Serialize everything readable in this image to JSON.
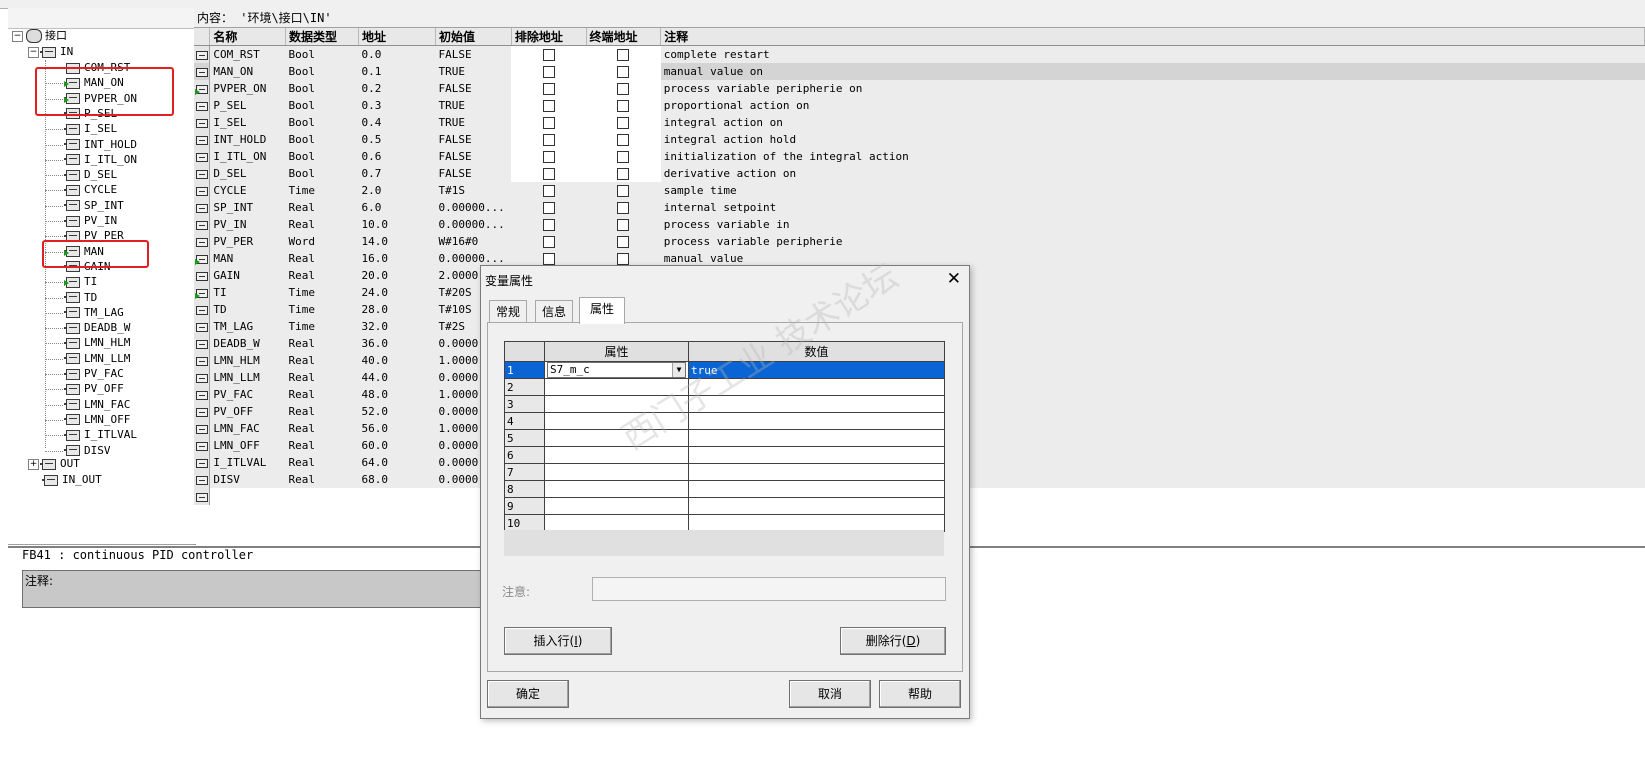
{
  "window": {
    "title_strip": ""
  },
  "tree": {
    "root": "接口",
    "in_folder": "IN",
    "in_items": [
      "COM_RST",
      "MAN_ON",
      "PVPER_ON",
      "P_SEL",
      "I_SEL",
      "INT_HOLD",
      "I_ITL_ON",
      "D_SEL",
      "CYCLE",
      "SP_INT",
      "PV_IN",
      "PV_PER",
      "MAN",
      "GAIN",
      "TI",
      "TD",
      "TM_LAG",
      "DEADB_W",
      "LMN_HLM",
      "LMN_LLM",
      "PV_FAC",
      "PV_OFF",
      "LMN_FAC",
      "LMN_OFF",
      "I_ITLVAL",
      "DISV"
    ],
    "out_folder": "OUT",
    "inout_folder": "IN_OUT",
    "expand_plus": "+",
    "expand_minus": "−"
  },
  "content_path": "内容：  '环境\\接口\\IN'",
  "table": {
    "headers": {
      "name": "名称",
      "type": "数据类型",
      "address": "地址",
      "initial": "初始值",
      "exclude": "排除地址",
      "terminal": "终端地址",
      "comment": "注释"
    },
    "rows": [
      {
        "name": "COM_RST",
        "type": "Bool",
        "address": "0.0",
        "initial": "FALSE",
        "comment": "complete restart"
      },
      {
        "name": "MAN_ON",
        "type": "Bool",
        "address": "0.1",
        "initial": "TRUE",
        "comment": "manual value on"
      },
      {
        "name": "PVPER_ON",
        "type": "Bool",
        "address": "0.2",
        "initial": "FALSE",
        "comment": "process variable peripherie on"
      },
      {
        "name": "P_SEL",
        "type": "Bool",
        "address": "0.3",
        "initial": "TRUE",
        "comment": "proportional action on"
      },
      {
        "name": "I_SEL",
        "type": "Bool",
        "address": "0.4",
        "initial": "TRUE",
        "comment": "integral action on"
      },
      {
        "name": "INT_HOLD",
        "type": "Bool",
        "address": "0.5",
        "initial": "FALSE",
        "comment": "integral action hold"
      },
      {
        "name": "I_ITL_ON",
        "type": "Bool",
        "address": "0.6",
        "initial": "FALSE",
        "comment": "initialization of the integral action"
      },
      {
        "name": "D_SEL",
        "type": "Bool",
        "address": "0.7",
        "initial": "FALSE",
        "comment": "derivative action on"
      },
      {
        "name": "CYCLE",
        "type": "Time",
        "address": "2.0",
        "initial": "T#1S",
        "comment": "sample time"
      },
      {
        "name": "SP_INT",
        "type": "Real",
        "address": "6.0",
        "initial": "0.00000...",
        "comment": "internal setpoint"
      },
      {
        "name": "PV_IN",
        "type": "Real",
        "address": "10.0",
        "initial": "0.00000...",
        "comment": "process variable in"
      },
      {
        "name": "PV_PER",
        "type": "Word",
        "address": "14.0",
        "initial": "W#16#0",
        "comment": "process variable peripherie"
      },
      {
        "name": "MAN",
        "type": "Real",
        "address": "16.0",
        "initial": "0.00000...",
        "comment": "manual value"
      },
      {
        "name": "GAIN",
        "type": "Real",
        "address": "20.0",
        "initial": "2.0000",
        "comment": ""
      },
      {
        "name": "TI",
        "type": "Time",
        "address": "24.0",
        "initial": "T#20S",
        "comment": ""
      },
      {
        "name": "TD",
        "type": "Time",
        "address": "28.0",
        "initial": "T#10S",
        "comment": ""
      },
      {
        "name": "TM_LAG",
        "type": "Time",
        "address": "32.0",
        "initial": "T#2S",
        "comment": ""
      },
      {
        "name": "DEADB_W",
        "type": "Real",
        "address": "36.0",
        "initial": "0.0000",
        "comment": ""
      },
      {
        "name": "LMN_HLM",
        "type": "Real",
        "address": "40.0",
        "initial": "1.0000",
        "comment": ""
      },
      {
        "name": "LMN_LLM",
        "type": "Real",
        "address": "44.0",
        "initial": "0.0000",
        "comment": ""
      },
      {
        "name": "PV_FAC",
        "type": "Real",
        "address": "48.0",
        "initial": "1.0000",
        "comment": ""
      },
      {
        "name": "PV_OFF",
        "type": "Real",
        "address": "52.0",
        "initial": "0.0000",
        "comment": ""
      },
      {
        "name": "LMN_FAC",
        "type": "Real",
        "address": "56.0",
        "initial": "1.0000",
        "comment": ""
      },
      {
        "name": "LMN_OFF",
        "type": "Real",
        "address": "60.0",
        "initial": "0.0000",
        "comment": ""
      },
      {
        "name": "I_ITLVAL",
        "type": "Real",
        "address": "64.0",
        "initial": "0.0000",
        "comment": ""
      },
      {
        "name": "DISV",
        "type": "Real",
        "address": "68.0",
        "initial": "0.0000",
        "comment": ""
      }
    ]
  },
  "lower": {
    "fb_title": "FB41 : continuous PID controller",
    "comment_label": "注释:"
  },
  "dialog": {
    "title": "变量属性",
    "close": "✕",
    "tabs": [
      "常规",
      "信息",
      "属性"
    ],
    "grid_headers": {
      "attr": "属性",
      "value": "数值"
    },
    "grid_rows": [
      {
        "n": "1",
        "attr": "S7_m_c",
        "value": "true"
      },
      {
        "n": "2",
        "attr": "",
        "value": ""
      },
      {
        "n": "3",
        "attr": "",
        "value": ""
      },
      {
        "n": "4",
        "attr": "",
        "value": ""
      },
      {
        "n": "5",
        "attr": "",
        "value": ""
      },
      {
        "n": "6",
        "attr": "",
        "value": ""
      },
      {
        "n": "7",
        "attr": "",
        "value": ""
      },
      {
        "n": "8",
        "attr": "",
        "value": ""
      },
      {
        "n": "9",
        "attr": "",
        "value": ""
      },
      {
        "n": "10",
        "attr": "",
        "value": ""
      }
    ],
    "note_label": "注意:",
    "insert_row": "插入行(",
    "insert_row_key": "I",
    "delete_row": "删除行(",
    "delete_row_key": "D",
    "ok": "确定",
    "cancel": "取消",
    "help": "帮助"
  },
  "watermark": "西门子工业 技术论坛"
}
